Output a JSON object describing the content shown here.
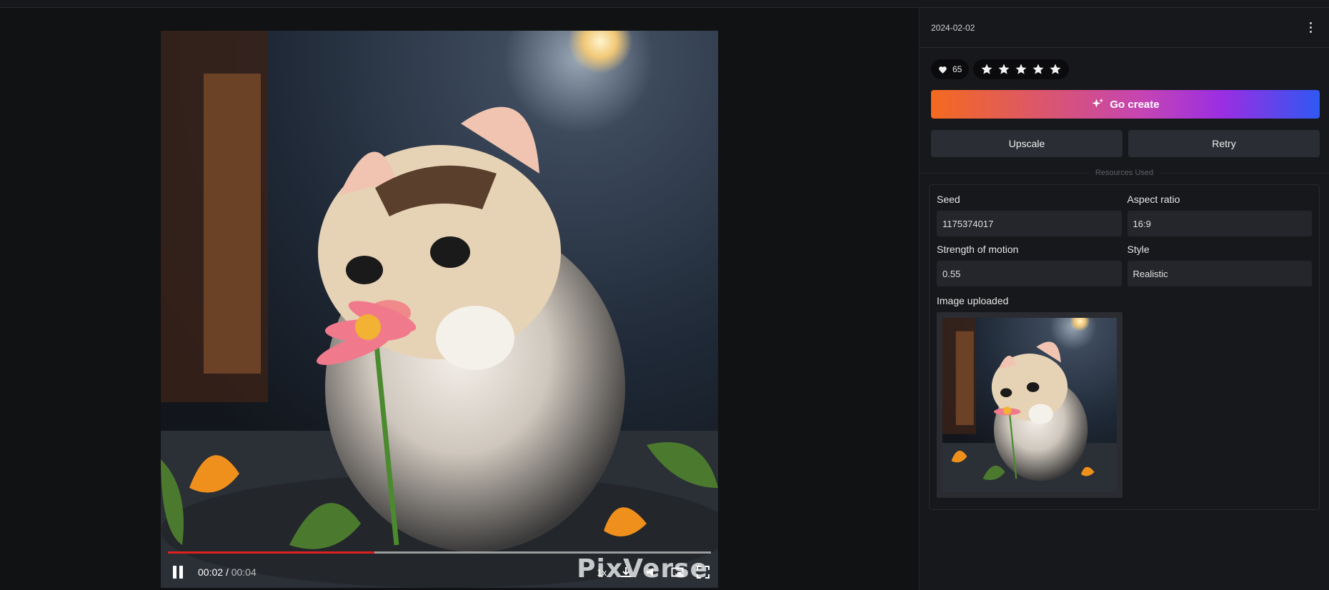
{
  "player": {
    "current_time": "00:02",
    "separator": "/",
    "duration": "00:04",
    "speed": "1x",
    "progress_fraction": 0.38,
    "watermark": "PixVerse"
  },
  "panel": {
    "date": "2024-02-02",
    "likes": "65",
    "stars": 5,
    "go_create_label": "Go create",
    "upscale_label": "Upscale",
    "retry_label": "Retry",
    "section_label": "Resources Used",
    "fields": {
      "seed_label": "Seed",
      "seed_value": "1175374017",
      "aspect_label": "Aspect ratio",
      "aspect_value": "16:9",
      "motion_label": "Strength of motion",
      "motion_value": "0.55",
      "style_label": "Style",
      "style_value": "Realistic"
    },
    "image_uploaded_label": "Image uploaded"
  },
  "colors": {
    "accent_gradient_start": "#f46a1f",
    "accent_gradient_mid": "#9a2ee2",
    "accent_gradient_end": "#2f58f2",
    "progress": "#e02020"
  },
  "icons": [
    "pause-icon",
    "download-icon",
    "volume-icon",
    "pip-icon",
    "fullscreen-icon",
    "heart-icon",
    "star-icon",
    "sparkle-icon",
    "more-vertical-icon"
  ]
}
